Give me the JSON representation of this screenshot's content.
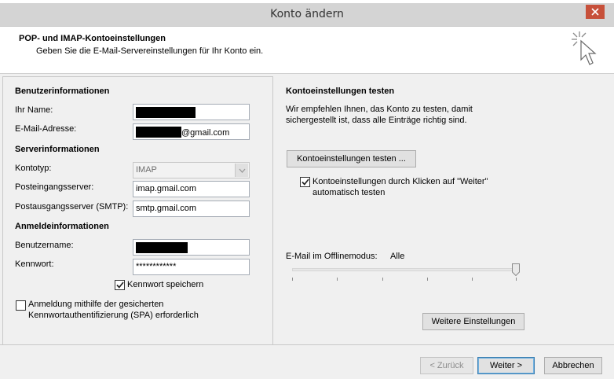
{
  "window": {
    "title": "Konto ändern"
  },
  "header": {
    "title": "POP- und IMAP-Kontoeinstellungen",
    "subtitle": "Geben Sie die E-Mail-Servereinstellungen für Ihr Konto ein."
  },
  "user_info": {
    "section_label": "Benutzerinformationen",
    "name_label": "Ihr Name:",
    "email_label": "E-Mail-Adresse:",
    "email_suffix": "@gmail.com"
  },
  "server_info": {
    "section_label": "Serverinformationen",
    "account_type_label": "Kontotyp:",
    "account_type_value": "IMAP",
    "incoming_label": "Posteingangsserver:",
    "incoming_value": "imap.gmail.com",
    "outgoing_label": "Postausgangsserver (SMTP):",
    "outgoing_value": "smtp.gmail.com"
  },
  "login_info": {
    "section_label": "Anmeldeinformationen",
    "username_label": "Benutzername:",
    "password_label": "Kennwort:",
    "password_value": "************",
    "remember_password_label": "Kennwort speichern",
    "remember_password_checked": true,
    "spa_label_line1": "Anmeldung mithilfe der gesicherten",
    "spa_label_line2": "Kennwortauthentifizierung (SPA) erforderlich",
    "spa_checked": false
  },
  "test_settings": {
    "section_label": "Kontoeinstellungen testen",
    "description_line1": "Wir empfehlen Ihnen, das Konto zu testen, damit",
    "description_line2": "sichergestellt ist, dass alle Einträge richtig sind.",
    "test_button_label": "Kontoeinstellungen testen ...",
    "auto_test_label_line1": "Kontoeinstellungen durch Klicken auf \"Weiter\"",
    "auto_test_label_line2": "automatisch testen",
    "auto_test_checked": true
  },
  "offline": {
    "label": "E-Mail im Offlinemodus:",
    "value": "Alle",
    "slider_level": 1.0
  },
  "buttons": {
    "more_settings": "Weitere Einstellungen",
    "back": "< Zurück",
    "next": "Weiter >",
    "cancel": "Abbrechen"
  },
  "colors": {
    "close_button": "#c7503a",
    "default_button_border": "#3c7fb1"
  },
  "icons": {
    "header_icon": "cursor-click-icon",
    "close": "close-icon",
    "checkbox": "checkmark-icon",
    "dropdown": "chevron-down-icon"
  }
}
